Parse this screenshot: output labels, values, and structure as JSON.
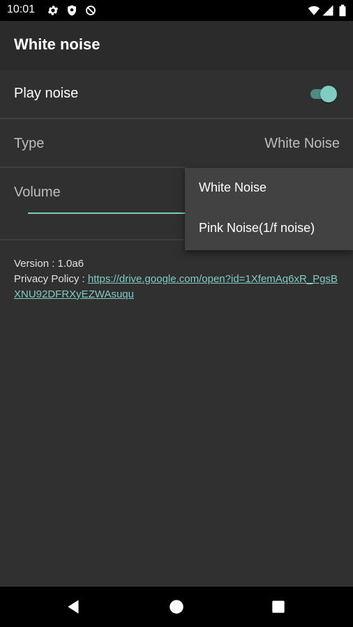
{
  "status_bar": {
    "time": "10:01",
    "left_icons": [
      "gear-icon",
      "shield-icon",
      "no-data-icon"
    ],
    "right_icons": [
      "wifi-icon",
      "signal-icon",
      "battery-icon"
    ]
  },
  "app_bar": {
    "title": "White noise"
  },
  "preferences": {
    "play_noise": {
      "label": "Play noise",
      "enabled": true
    },
    "type": {
      "label": "Type",
      "value": "White Noise"
    },
    "volume": {
      "label": "Volume"
    }
  },
  "info": {
    "version": "Version : 1.0a6",
    "privacy_label": "Privacy Policy : ",
    "privacy_link": "https://drive.google.com/open?id=1XfemAq6xR_PgsBXNU92DFRXyEZWAsuqu"
  },
  "type_menu": {
    "options": [
      "White Noise",
      "Pink Noise(1/f noise)"
    ]
  },
  "nav_bar": {
    "buttons": [
      "back-icon",
      "home-icon",
      "recents-icon"
    ]
  },
  "colors": {
    "accent": "#80cbc4",
    "background": "#303030",
    "app_bar": "#2b2b2b",
    "menu": "#424242"
  }
}
